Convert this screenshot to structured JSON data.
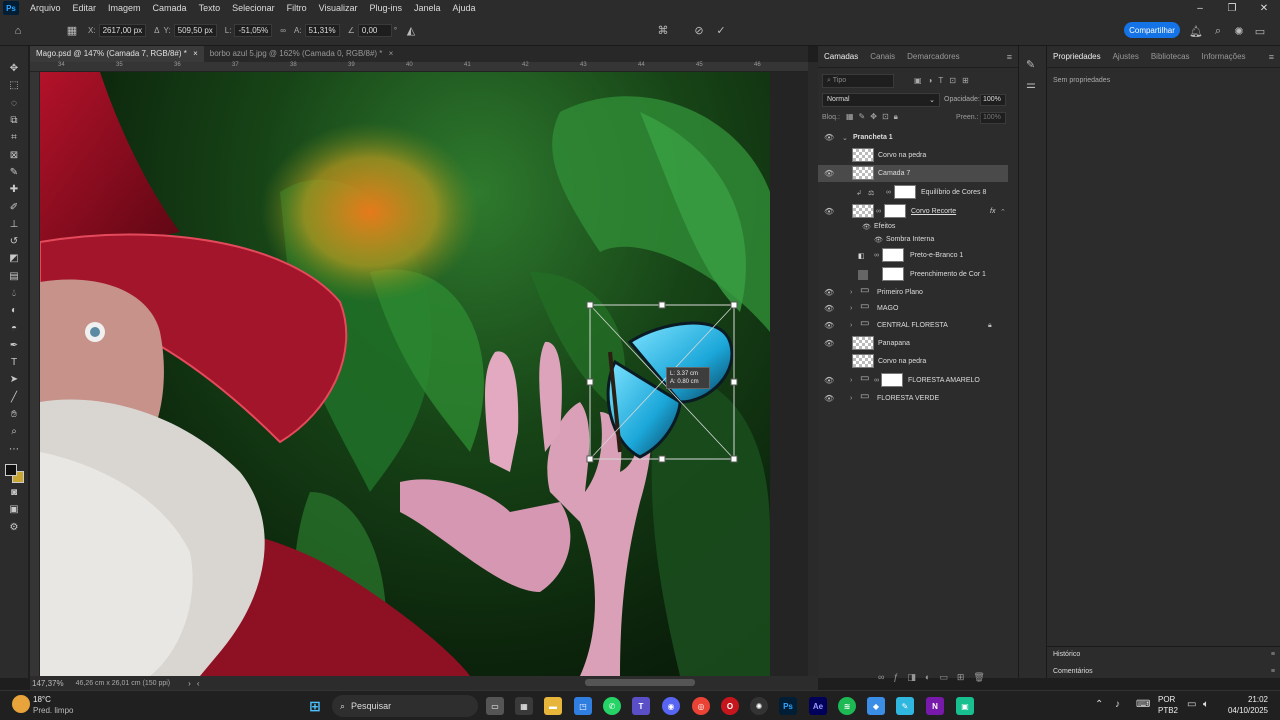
{
  "menu": {
    "items": [
      "Arquivo",
      "Editar",
      "Imagem",
      "Camada",
      "Texto",
      "Selecionar",
      "Filtro",
      "Visualizar",
      "Plug-ins",
      "Janela",
      "Ajuda"
    ]
  },
  "options": {
    "x_label": "X:",
    "x_value": "2617,00 px",
    "y_label": "Y:",
    "y_value": "509,50 px",
    "w_label": "L:",
    "w_value": "-51,05%",
    "h_label": "A:",
    "h_value": "51,31%",
    "angle_value": "0,00",
    "angle_unit": "°",
    "share_label": "Compartilhar"
  },
  "tabs": [
    {
      "label": "Mago.psd @ 147% (Camada 7, RGB/8#) *"
    },
    {
      "label": "borbo azul 5.jpg @ 162% (Camada 0, RGB/8#) *"
    }
  ],
  "ruler": {
    "h_ticks": [
      "34",
      "35",
      "36",
      "37",
      "38",
      "39",
      "40",
      "41",
      "42",
      "43",
      "44",
      "45",
      "46"
    ]
  },
  "canvas": {
    "transform_tooltip_w": "L: 3.37 cm",
    "transform_tooltip_h": "A: 0.80 cm"
  },
  "status": {
    "zoom": "147,37%",
    "doc_size": "46,26 cm x 26,01 cm (150 ppi)"
  },
  "layers_panel": {
    "tabs": [
      "Camadas",
      "Canais",
      "Demarcadores"
    ],
    "search_placeholder": "Tipo",
    "blend_mode": "Normal",
    "opacity_label": "Opacidade:",
    "opacity_value": "100%",
    "lock_label": "Bloq.:",
    "fill_label": "Preen.:",
    "fill_value": "100%",
    "layers": [
      {
        "name": "Prancheta 1",
        "type": "artboard",
        "visible": true
      },
      {
        "name": "Corvo na pedra",
        "type": "layer",
        "visible": false
      },
      {
        "name": "Camada 7",
        "type": "layer",
        "visible": true,
        "selected": true
      },
      {
        "name": "Equilíbrio de Cores 8",
        "type": "adjustment",
        "visible": false
      },
      {
        "name": "Corvo Recorte",
        "type": "layer",
        "visible": true,
        "fx": "fx"
      },
      {
        "name": "Efeitos",
        "type": "effects"
      },
      {
        "name": "Sombra Interna",
        "type": "effect"
      },
      {
        "name": "Preto-e-Branco 1",
        "type": "adjustment",
        "visible": false
      },
      {
        "name": "Preenchimento de Cor 1",
        "type": "fill",
        "visible": false
      },
      {
        "name": "Primeiro Plano",
        "type": "folder",
        "visible": true
      },
      {
        "name": "MAGO",
        "type": "folder",
        "visible": true
      },
      {
        "name": "CENTRAL FLORESTA",
        "type": "folder",
        "visible": true,
        "locked": true
      },
      {
        "name": "Panapana",
        "type": "layer",
        "visible": true
      },
      {
        "name": "Corvo na pedra",
        "type": "layer",
        "visible": false
      },
      {
        "name": "FLORESTA AMARELO",
        "type": "folder",
        "visible": true
      },
      {
        "name": "FLORESTA VERDE",
        "type": "folder",
        "visible": true
      }
    ]
  },
  "properties": {
    "tabs": [
      "Propriedades",
      "Ajustes",
      "Bibliotecas",
      "Informações"
    ],
    "empty_text": "Sem propriedades",
    "history_label": "Histórico",
    "comments_label": "Comentários"
  },
  "taskbar": {
    "weather_temp": "18°C",
    "weather_desc": "Pred. limpo",
    "search_label": "Pesquisar",
    "lang_line1": "POR",
    "lang_line2": "PTB2",
    "time": "21:02",
    "date": "04/10/2025"
  }
}
